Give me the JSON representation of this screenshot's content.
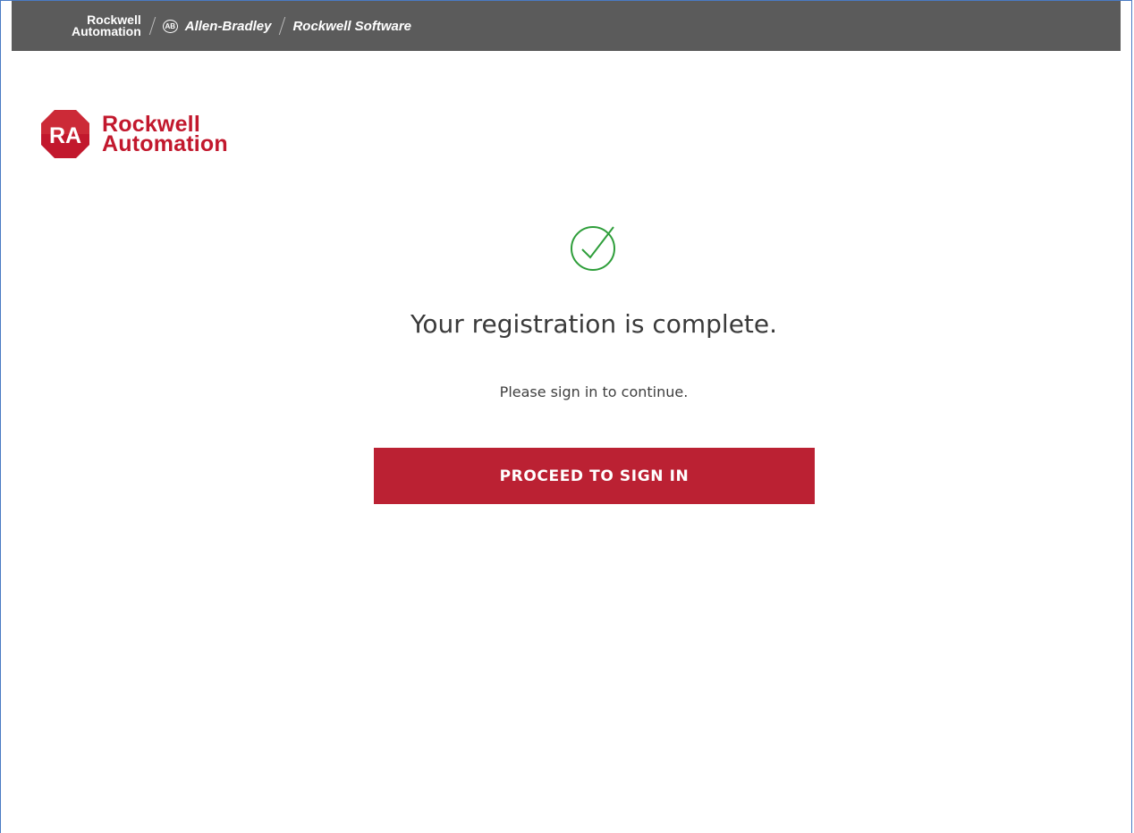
{
  "header": {
    "brand_line1": "Rockwell",
    "brand_line2": "Automation",
    "ab_badge": "AB",
    "ab_label": "Allen-Bradley",
    "software_label": "Rockwell Software"
  },
  "logo": {
    "mark_text": "RA",
    "line1": "Rockwell",
    "line2": "Automation",
    "color": "#c2182d"
  },
  "main": {
    "status_icon": "check-circle-icon",
    "success_color": "#2e9e3a",
    "title": "Your registration is complete.",
    "subtitle": "Please sign in to continue.",
    "button_label": "PROCEED TO SIGN IN",
    "button_color": "#bb2133"
  }
}
